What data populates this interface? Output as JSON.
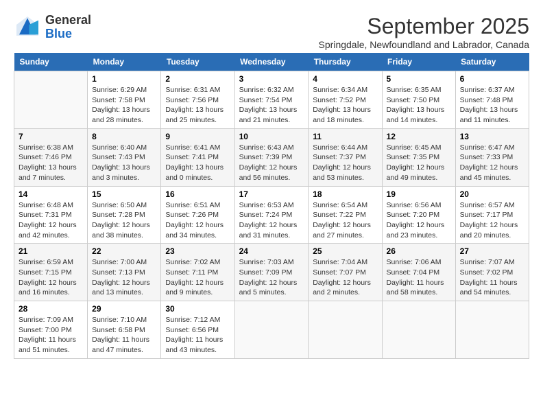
{
  "logo": {
    "text_general": "General",
    "text_blue": "Blue"
  },
  "title": "September 2025",
  "subtitle": "Springdale, Newfoundland and Labrador, Canada",
  "days_of_week": [
    "Sunday",
    "Monday",
    "Tuesday",
    "Wednesday",
    "Thursday",
    "Friday",
    "Saturday"
  ],
  "weeks": [
    [
      {
        "num": "",
        "info": ""
      },
      {
        "num": "1",
        "info": "Sunrise: 6:29 AM\nSunset: 7:58 PM\nDaylight: 13 hours\nand 28 minutes."
      },
      {
        "num": "2",
        "info": "Sunrise: 6:31 AM\nSunset: 7:56 PM\nDaylight: 13 hours\nand 25 minutes."
      },
      {
        "num": "3",
        "info": "Sunrise: 6:32 AM\nSunset: 7:54 PM\nDaylight: 13 hours\nand 21 minutes."
      },
      {
        "num": "4",
        "info": "Sunrise: 6:34 AM\nSunset: 7:52 PM\nDaylight: 13 hours\nand 18 minutes."
      },
      {
        "num": "5",
        "info": "Sunrise: 6:35 AM\nSunset: 7:50 PM\nDaylight: 13 hours\nand 14 minutes."
      },
      {
        "num": "6",
        "info": "Sunrise: 6:37 AM\nSunset: 7:48 PM\nDaylight: 13 hours\nand 11 minutes."
      }
    ],
    [
      {
        "num": "7",
        "info": "Sunrise: 6:38 AM\nSunset: 7:46 PM\nDaylight: 13 hours\nand 7 minutes."
      },
      {
        "num": "8",
        "info": "Sunrise: 6:40 AM\nSunset: 7:43 PM\nDaylight: 13 hours\nand 3 minutes."
      },
      {
        "num": "9",
        "info": "Sunrise: 6:41 AM\nSunset: 7:41 PM\nDaylight: 13 hours\nand 0 minutes."
      },
      {
        "num": "10",
        "info": "Sunrise: 6:43 AM\nSunset: 7:39 PM\nDaylight: 12 hours\nand 56 minutes."
      },
      {
        "num": "11",
        "info": "Sunrise: 6:44 AM\nSunset: 7:37 PM\nDaylight: 12 hours\nand 53 minutes."
      },
      {
        "num": "12",
        "info": "Sunrise: 6:45 AM\nSunset: 7:35 PM\nDaylight: 12 hours\nand 49 minutes."
      },
      {
        "num": "13",
        "info": "Sunrise: 6:47 AM\nSunset: 7:33 PM\nDaylight: 12 hours\nand 45 minutes."
      }
    ],
    [
      {
        "num": "14",
        "info": "Sunrise: 6:48 AM\nSunset: 7:31 PM\nDaylight: 12 hours\nand 42 minutes."
      },
      {
        "num": "15",
        "info": "Sunrise: 6:50 AM\nSunset: 7:28 PM\nDaylight: 12 hours\nand 38 minutes."
      },
      {
        "num": "16",
        "info": "Sunrise: 6:51 AM\nSunset: 7:26 PM\nDaylight: 12 hours\nand 34 minutes."
      },
      {
        "num": "17",
        "info": "Sunrise: 6:53 AM\nSunset: 7:24 PM\nDaylight: 12 hours\nand 31 minutes."
      },
      {
        "num": "18",
        "info": "Sunrise: 6:54 AM\nSunset: 7:22 PM\nDaylight: 12 hours\nand 27 minutes."
      },
      {
        "num": "19",
        "info": "Sunrise: 6:56 AM\nSunset: 7:20 PM\nDaylight: 12 hours\nand 23 minutes."
      },
      {
        "num": "20",
        "info": "Sunrise: 6:57 AM\nSunset: 7:17 PM\nDaylight: 12 hours\nand 20 minutes."
      }
    ],
    [
      {
        "num": "21",
        "info": "Sunrise: 6:59 AM\nSunset: 7:15 PM\nDaylight: 12 hours\nand 16 minutes."
      },
      {
        "num": "22",
        "info": "Sunrise: 7:00 AM\nSunset: 7:13 PM\nDaylight: 12 hours\nand 13 minutes."
      },
      {
        "num": "23",
        "info": "Sunrise: 7:02 AM\nSunset: 7:11 PM\nDaylight: 12 hours\nand 9 minutes."
      },
      {
        "num": "24",
        "info": "Sunrise: 7:03 AM\nSunset: 7:09 PM\nDaylight: 12 hours\nand 5 minutes."
      },
      {
        "num": "25",
        "info": "Sunrise: 7:04 AM\nSunset: 7:07 PM\nDaylight: 12 hours\nand 2 minutes."
      },
      {
        "num": "26",
        "info": "Sunrise: 7:06 AM\nSunset: 7:04 PM\nDaylight: 11 hours\nand 58 minutes."
      },
      {
        "num": "27",
        "info": "Sunrise: 7:07 AM\nSunset: 7:02 PM\nDaylight: 11 hours\nand 54 minutes."
      }
    ],
    [
      {
        "num": "28",
        "info": "Sunrise: 7:09 AM\nSunset: 7:00 PM\nDaylight: 11 hours\nand 51 minutes."
      },
      {
        "num": "29",
        "info": "Sunrise: 7:10 AM\nSunset: 6:58 PM\nDaylight: 11 hours\nand 47 minutes."
      },
      {
        "num": "30",
        "info": "Sunrise: 7:12 AM\nSunset: 6:56 PM\nDaylight: 11 hours\nand 43 minutes."
      },
      {
        "num": "",
        "info": ""
      },
      {
        "num": "",
        "info": ""
      },
      {
        "num": "",
        "info": ""
      },
      {
        "num": "",
        "info": ""
      }
    ]
  ]
}
